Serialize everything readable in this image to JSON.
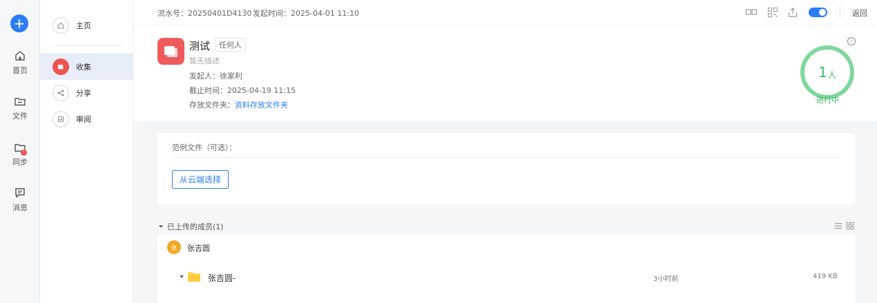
{
  "rail": {
    "items": [
      {
        "label": "首页",
        "icon": "home-icon"
      },
      {
        "label": "文件",
        "icon": "folder-icon"
      },
      {
        "label": "同步",
        "icon": "sync-folder-icon",
        "badge": "!"
      },
      {
        "label": "消息",
        "icon": "message-icon"
      }
    ],
    "add_icon": "+"
  },
  "nav": {
    "home": "主页",
    "collect": "收集",
    "share": "分享",
    "review": "审阅"
  },
  "topbar": {
    "serial_label": "流水号：",
    "serial_value": "20250401D4130",
    "start_label": "发起时间：",
    "start_value": "2025-04-01 11:10",
    "back": "返回"
  },
  "task": {
    "title": "测试",
    "tag": "任何人",
    "description": "暂无描述",
    "initiator_label": "发起人：",
    "initiator": "徐家利",
    "deadline_label": "截止时间：",
    "deadline": "2025-04-19 11:15",
    "folder_label": "存放文件夹：",
    "folder": "资料存放文件夹",
    "count": "1",
    "count_unit": "人",
    "status": "进行中",
    "info_icon": "i"
  },
  "sample": {
    "title": "范例文件（可选）：",
    "cloud_button": "从云端选择"
  },
  "members": {
    "header": "已上传的成员(1)",
    "list": [
      {
        "avatar": "张",
        "name": "张吉圆",
        "files": [
          {
            "name": "张吉圆-",
            "time": "3小时前",
            "size": "419 KB"
          }
        ]
      }
    ]
  },
  "colors": {
    "accent": "#2b7cf6",
    "red": "#ef5b5b",
    "green": "#39b96a",
    "avatar": "#f5a623"
  }
}
